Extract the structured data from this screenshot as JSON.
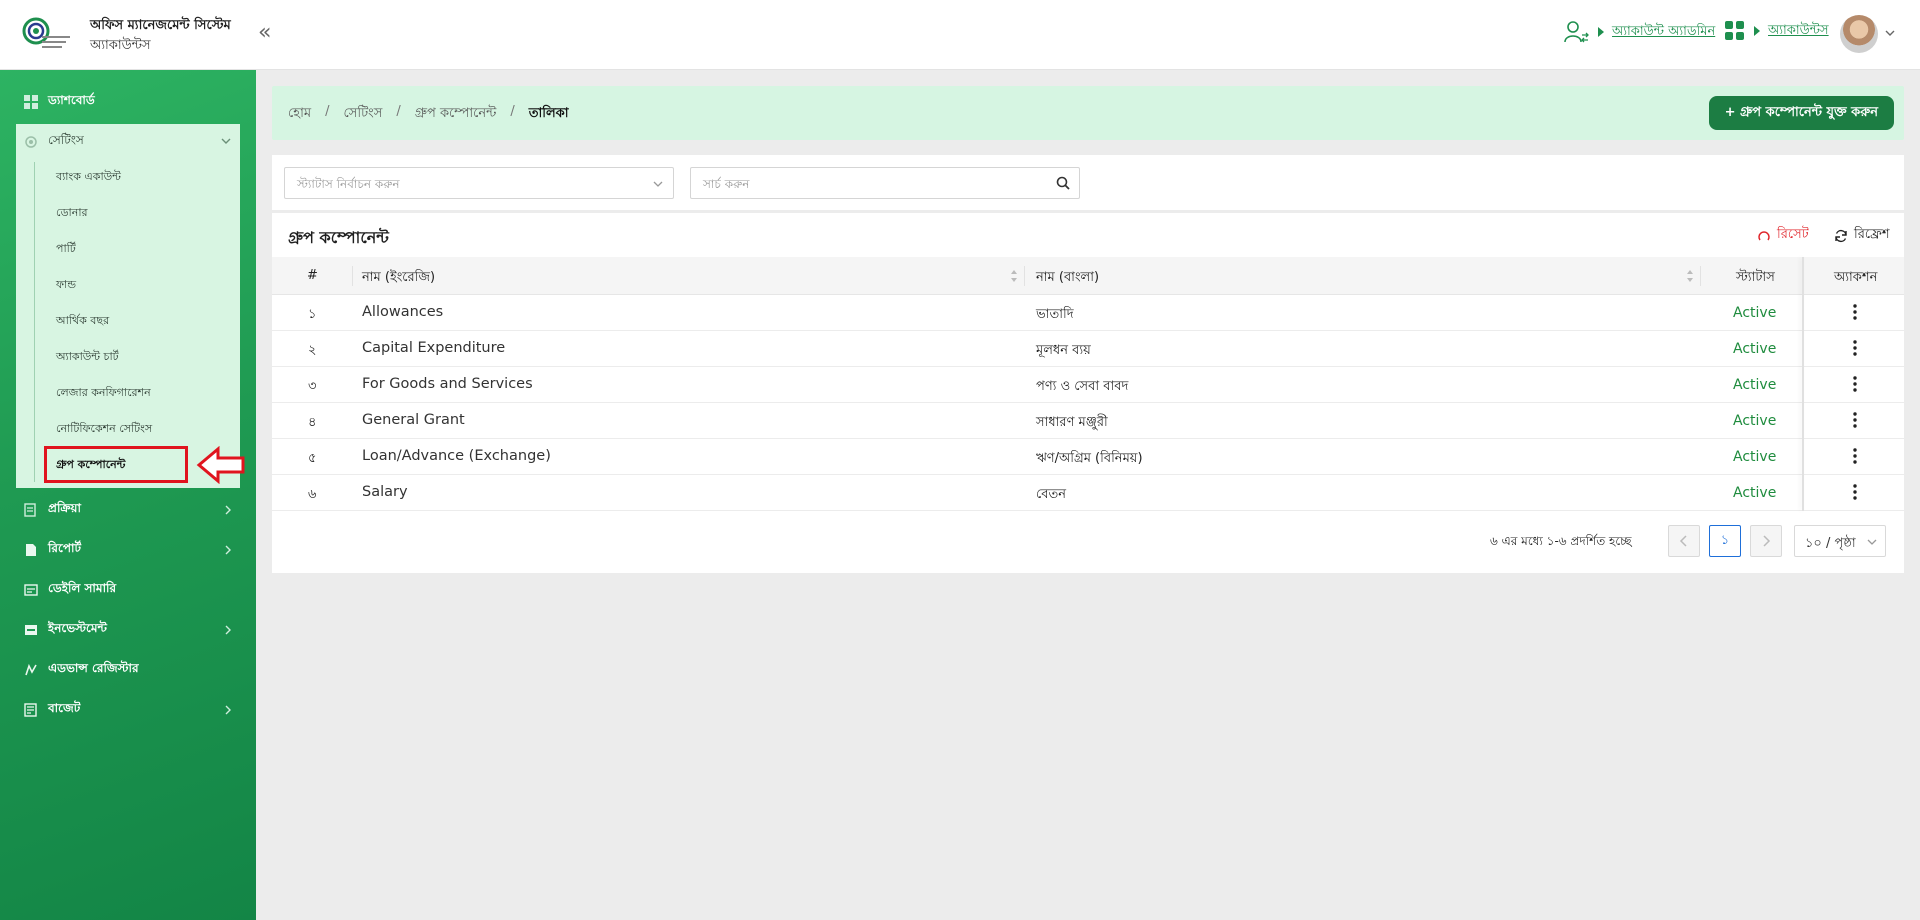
{
  "header": {
    "app_title": "অফিস ম্যানেজমেন্ট সিস্টেম",
    "app_subtitle": "অ্যাকাউন্টস",
    "user_role_link": "অ্যাকাউন্ট অ্যাডমিন",
    "module_link": "অ্যাকাউন্টস",
    "accent_color": "#1e8f4e"
  },
  "sidebar": {
    "items": [
      {
        "label": "ড্যাশবোর্ড",
        "icon": "dashboard-icon"
      },
      {
        "label": "প্রক্রিয়া",
        "icon": "process-icon"
      },
      {
        "label": "রিপোর্ট",
        "icon": "report-icon"
      },
      {
        "label": "ডেইলি সামারি",
        "icon": "daily-summary-icon"
      },
      {
        "label": "ইনভেস্টমেন্ট",
        "icon": "investment-icon"
      },
      {
        "label": "এডভান্স রেজিস্টার",
        "icon": "advance-register-icon"
      },
      {
        "label": "বাজেট",
        "icon": "budget-icon"
      }
    ],
    "settings": {
      "label": "সেটিংস",
      "subitems": [
        "ব্যাংক একাউন্ট",
        "ডোনার",
        "পার্টি",
        "ফান্ড",
        "আর্থিক বছর",
        "অ্যাকাউন্ট চার্ট",
        "লেজার কনফিগারেশন",
        "নোটিফিকেশন সেটিংস",
        "গ্রুপ কম্পোনেন্ট"
      ]
    }
  },
  "breadcrumb": {
    "home": "হোম",
    "settings": "সেটিংস",
    "section": "গ্রুপ কম্পোনেন্ট",
    "current": "তালিকা"
  },
  "add_button": "+ গ্রুপ কম্পোনেন্ট যুক্ত করুন",
  "filters": {
    "status_placeholder": "স্ট্যাটাস নির্বাচন করুন",
    "search_placeholder": "সার্চ করুন"
  },
  "table": {
    "title": "গ্রুপ কম্পোনেন্ট",
    "reset_label": "রিসেট",
    "refresh_label": "রিফ্রেশ",
    "headers": [
      "#",
      "নাম (ইংরেজি)",
      "নাম (বাংলা)",
      "স্ট্যাটাস",
      "অ্যাকশন"
    ],
    "rows": [
      {
        "no": "১",
        "name_en": "Allowances",
        "name_bn": "ভাতাদি",
        "status": "Active"
      },
      {
        "no": "২",
        "name_en": "Capital Expenditure",
        "name_bn": "মূলধন ব্যয়",
        "status": "Active"
      },
      {
        "no": "৩",
        "name_en": "For Goods and Services",
        "name_bn": "পণ্য ও সেবা বাবদ",
        "status": "Active"
      },
      {
        "no": "৪",
        "name_en": "General Grant",
        "name_bn": "সাধারণ মঞ্জুরী",
        "status": "Active"
      },
      {
        "no": "৫",
        "name_en": "Loan/Advance (Exchange)",
        "name_bn": "ঋণ/অগ্রিম (বিনিময়)",
        "status": "Active"
      },
      {
        "no": "৬",
        "name_en": "Salary",
        "name_bn": "বেতন",
        "status": "Active"
      }
    ],
    "status_color": "#1f8c3e"
  },
  "pagination": {
    "info": "৬ এর মধ্যে ১-৬ প্রদর্শিত হচ্ছে",
    "current_page": "১",
    "page_size": "১০ / পৃষ্ঠা"
  }
}
